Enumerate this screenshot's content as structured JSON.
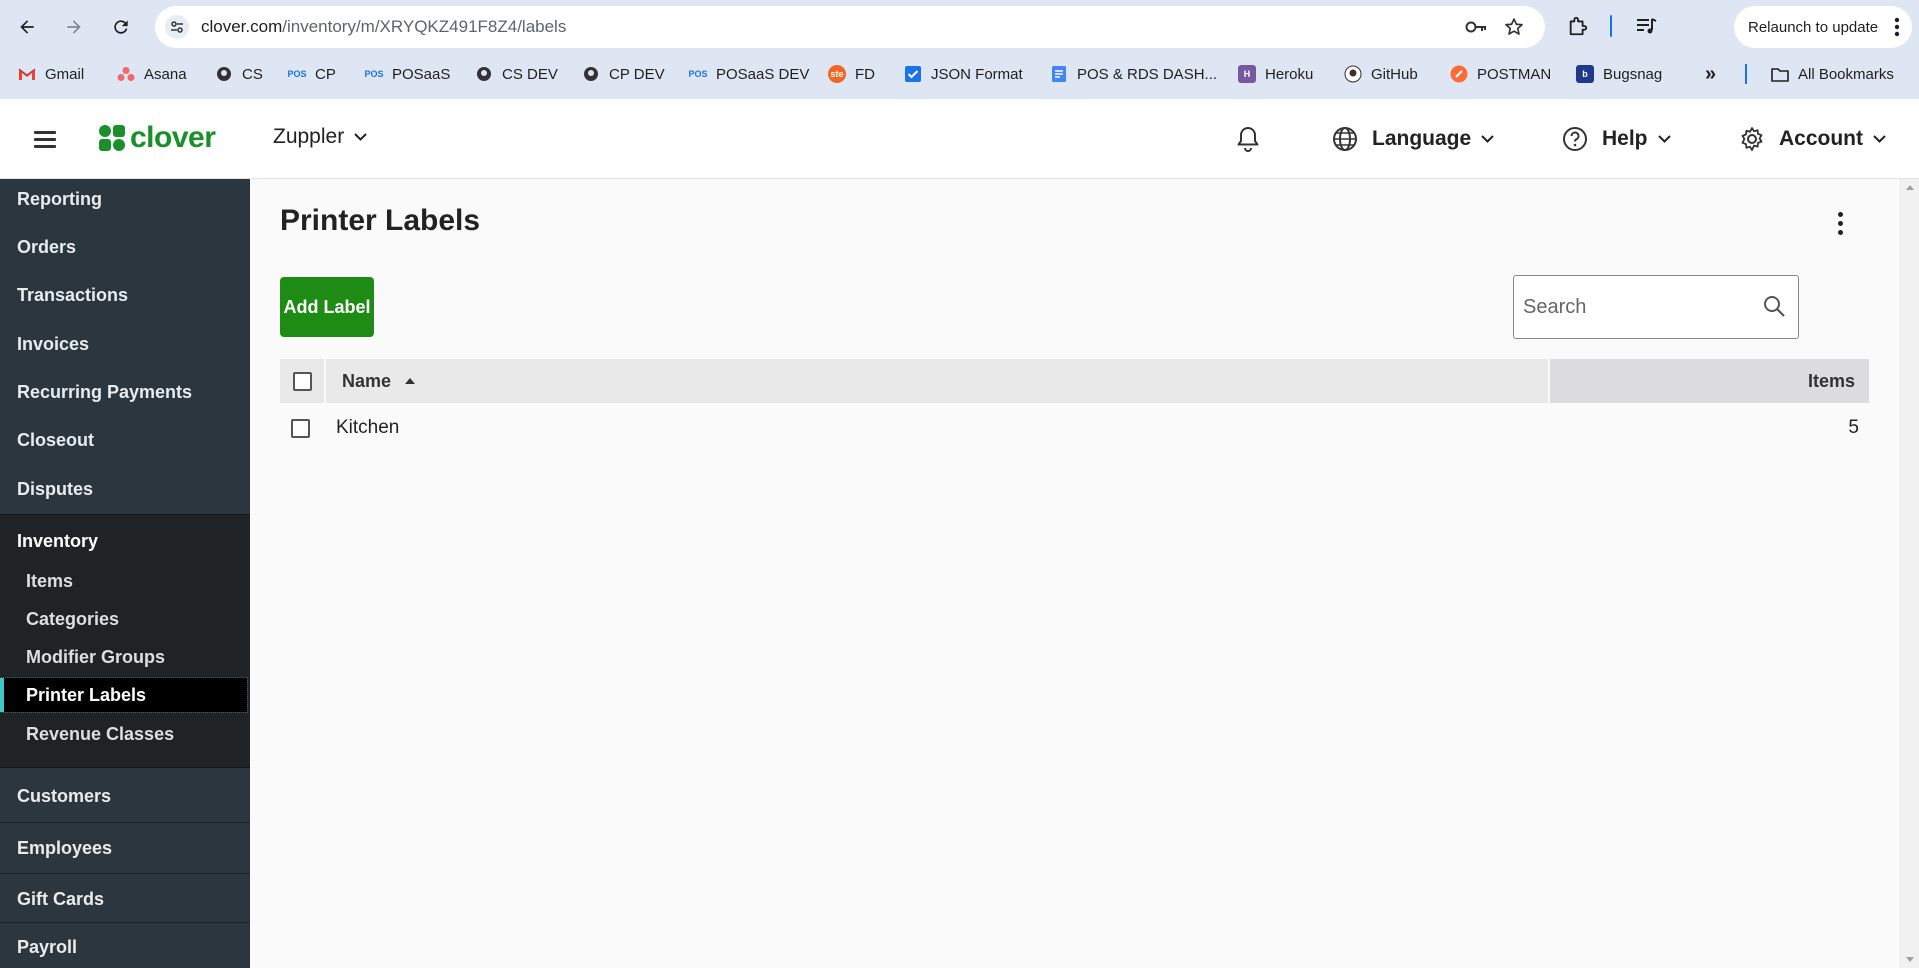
{
  "browser": {
    "url_host": "clover.com",
    "url_path": "/inventory/m/XRYQKZ491F8Z4/labels",
    "relaunch_label": "Relaunch to update",
    "bookmarks": [
      {
        "label": "Gmail",
        "icon": "gmail-icon"
      },
      {
        "label": "Asana",
        "icon": "asana-icon"
      },
      {
        "label": "CS",
        "icon": "github-icon"
      },
      {
        "label": "CP",
        "icon": "pos-icon",
        "badge": "POS"
      },
      {
        "label": "POSaaS",
        "icon": "pos-icon",
        "badge": "POS"
      },
      {
        "label": "CS DEV",
        "icon": "github-icon"
      },
      {
        "label": "CP DEV",
        "icon": "github-icon"
      },
      {
        "label": "POSaaS DEV",
        "icon": "pos-icon",
        "badge": "POS"
      },
      {
        "label": "FD",
        "icon": "fd-icon",
        "badge": "ste"
      },
      {
        "label": "JSON Format",
        "icon": "checkbox-icon"
      },
      {
        "label": "POS & RDS DASH...",
        "icon": "doc-icon"
      },
      {
        "label": "Heroku",
        "icon": "heroku-icon",
        "badge": "H"
      },
      {
        "label": "GitHub",
        "icon": "github-icon"
      },
      {
        "label": "POSTMAN",
        "icon": "postman-icon"
      },
      {
        "label": "Bugsnag",
        "icon": "bugsnag-icon",
        "badge": "b"
      }
    ],
    "more_label": "»",
    "all_bookmarks_label": "All Bookmarks"
  },
  "header": {
    "logo_text": "clover",
    "merchant_name": "Zuppler",
    "language_label": "Language",
    "help_label": "Help",
    "account_label": "Account"
  },
  "sidebar": {
    "top_items": [
      "Reporting",
      "Orders",
      "Transactions",
      "Invoices",
      "Recurring Payments",
      "Closeout",
      "Disputes"
    ],
    "group_label": "Inventory",
    "sub_items": [
      "Items",
      "Categories",
      "Modifier Groups",
      "Printer Labels",
      "Revenue Classes"
    ],
    "active_sub_item": "Printer Labels",
    "bottom_items": [
      "Customers",
      "Employees",
      "Gift Cards",
      "Payroll"
    ]
  },
  "main": {
    "page_title": "Printer Labels",
    "add_button_label": "Add Label",
    "search_placeholder": "Search",
    "table": {
      "columns": [
        "Name",
        "Items"
      ],
      "sort_column": "Name",
      "sort_direction": "ascending",
      "rows": [
        {
          "name": "Kitchen",
          "items": "5"
        }
      ]
    }
  },
  "colors": {
    "brand_green": "#1b8f2a",
    "button_green": "#1e8b14",
    "sidebar_bg": "#2c363e",
    "active_accent": "#43c6c6"
  }
}
